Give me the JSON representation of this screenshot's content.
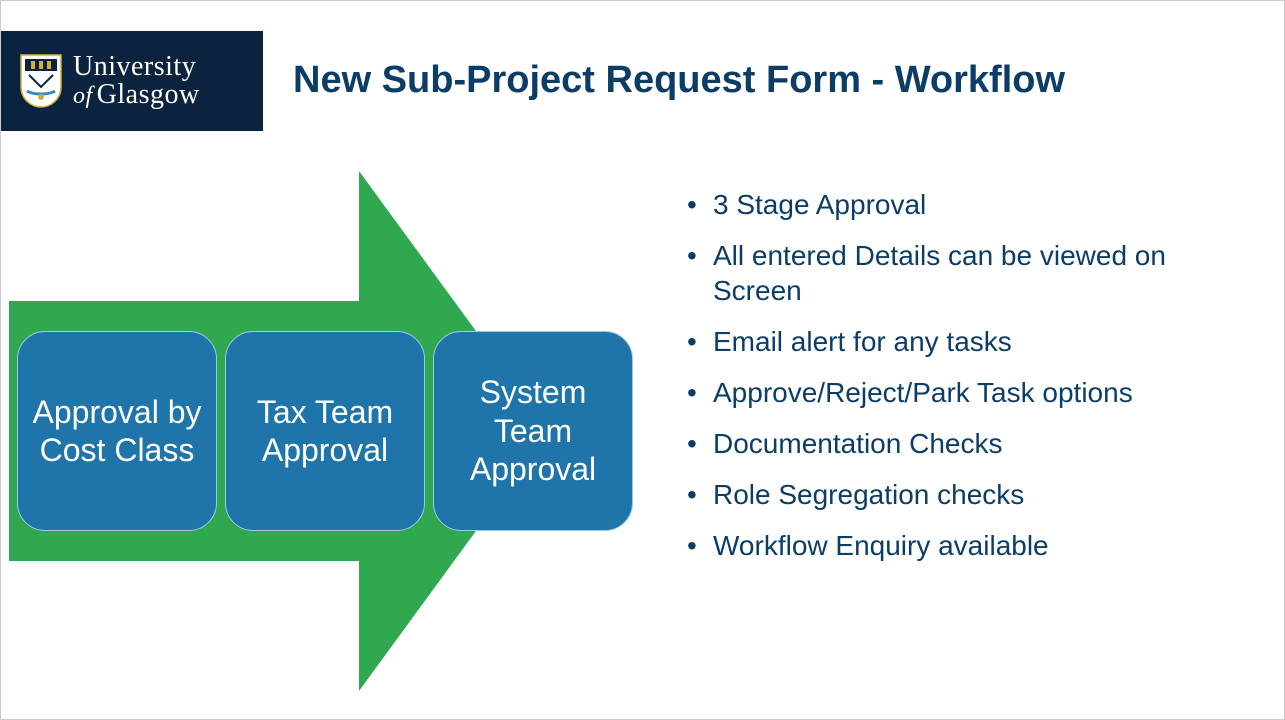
{
  "logo": {
    "line1": "University",
    "of": "of",
    "line2": "Glasgow"
  },
  "title": "New Sub-Project Request Form - Workflow",
  "stages": {
    "s1": "Approval by Cost Class",
    "s2": "Tax Team Approval",
    "s3": "System Team Approval"
  },
  "bullets": {
    "b1": "3 Stage Approval",
    "b2": "All entered Details can be viewed on Screen",
    "b3": "Email alert for any tasks",
    "b4": "Approve/Reject/Park Task options",
    "b5": "Documentation Checks",
    "b6": "Role Segregation checks",
    "b7": "Workflow Enquiry available"
  }
}
